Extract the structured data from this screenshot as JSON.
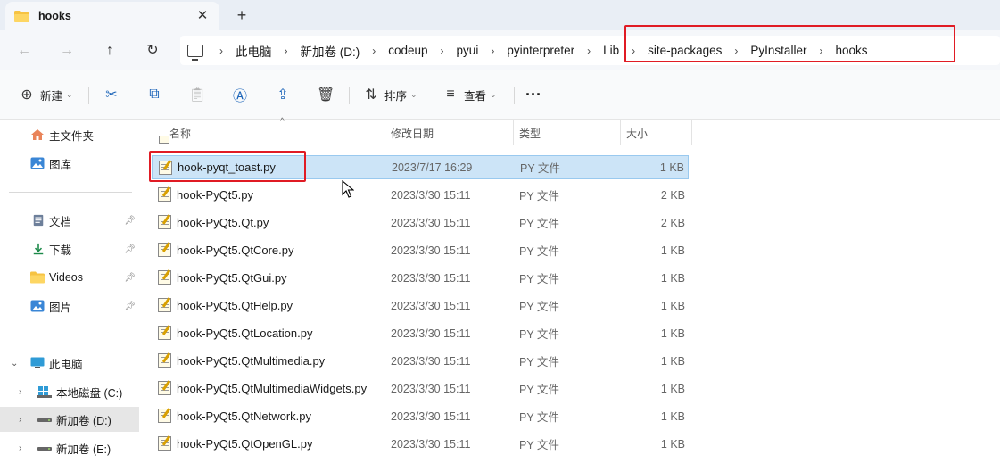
{
  "tab": {
    "title": "hooks",
    "close": "✕",
    "new": "+"
  },
  "nav": {
    "back": "←",
    "forward": "→",
    "up": "↑",
    "refresh": "↻"
  },
  "breadcrumbs": [
    "此电脑",
    "新加卷 (D:)",
    "codeup",
    "pyui",
    "pyinterpreter",
    "Lib",
    "site-packages",
    "PyInstaller",
    "hooks"
  ],
  "commands": {
    "new": "新建",
    "sort": "排序",
    "view": "查看",
    "more": "···"
  },
  "sidebar": {
    "quick": [
      {
        "label": "主文件夹",
        "icon": "home-icon"
      },
      {
        "label": "图库",
        "icon": "gallery-icon"
      }
    ],
    "pinned": [
      {
        "label": "文档",
        "icon": "document-icon"
      },
      {
        "label": "下载",
        "icon": "download-icon"
      },
      {
        "label": "Videos",
        "icon": "folder-icon"
      },
      {
        "label": "图片",
        "icon": "pictures-icon"
      }
    ],
    "this_pc": "此电脑",
    "drives": [
      {
        "label": "本地磁盘 (C:)"
      },
      {
        "label": "新加卷 (D:)"
      },
      {
        "label": "新加卷 (E:)"
      }
    ]
  },
  "columns": {
    "name": "名称",
    "modified": "修改日期",
    "type": "类型",
    "size": "大小"
  },
  "files": [
    {
      "name": "hook-pyqt_toast.py",
      "date": "2023/7/17 16:29",
      "type": "PY 文件",
      "size": "1 KB",
      "selected": true
    },
    {
      "name": "hook-PyQt5.py",
      "date": "2023/3/30 15:11",
      "type": "PY 文件",
      "size": "2 KB"
    },
    {
      "name": "hook-PyQt5.Qt.py",
      "date": "2023/3/30 15:11",
      "type": "PY 文件",
      "size": "2 KB"
    },
    {
      "name": "hook-PyQt5.QtCore.py",
      "date": "2023/3/30 15:11",
      "type": "PY 文件",
      "size": "1 KB"
    },
    {
      "name": "hook-PyQt5.QtGui.py",
      "date": "2023/3/30 15:11",
      "type": "PY 文件",
      "size": "1 KB"
    },
    {
      "name": "hook-PyQt5.QtHelp.py",
      "date": "2023/3/30 15:11",
      "type": "PY 文件",
      "size": "1 KB"
    },
    {
      "name": "hook-PyQt5.QtLocation.py",
      "date": "2023/3/30 15:11",
      "type": "PY 文件",
      "size": "1 KB"
    },
    {
      "name": "hook-PyQt5.QtMultimedia.py",
      "date": "2023/3/30 15:11",
      "type": "PY 文件",
      "size": "1 KB"
    },
    {
      "name": "hook-PyQt5.QtMultimediaWidgets.py",
      "date": "2023/3/30 15:11",
      "type": "PY 文件",
      "size": "1 KB"
    },
    {
      "name": "hook-PyQt5.QtNetwork.py",
      "date": "2023/3/30 15:11",
      "type": "PY 文件",
      "size": "1 KB"
    },
    {
      "name": "hook-PyQt5.QtOpenGL.py",
      "date": "2023/3/30 15:11",
      "type": "PY 文件",
      "size": "1 KB"
    }
  ],
  "colors": {
    "selection": "#cce4f7",
    "highlight": "#e01b24",
    "accent": "#1a63b8"
  }
}
